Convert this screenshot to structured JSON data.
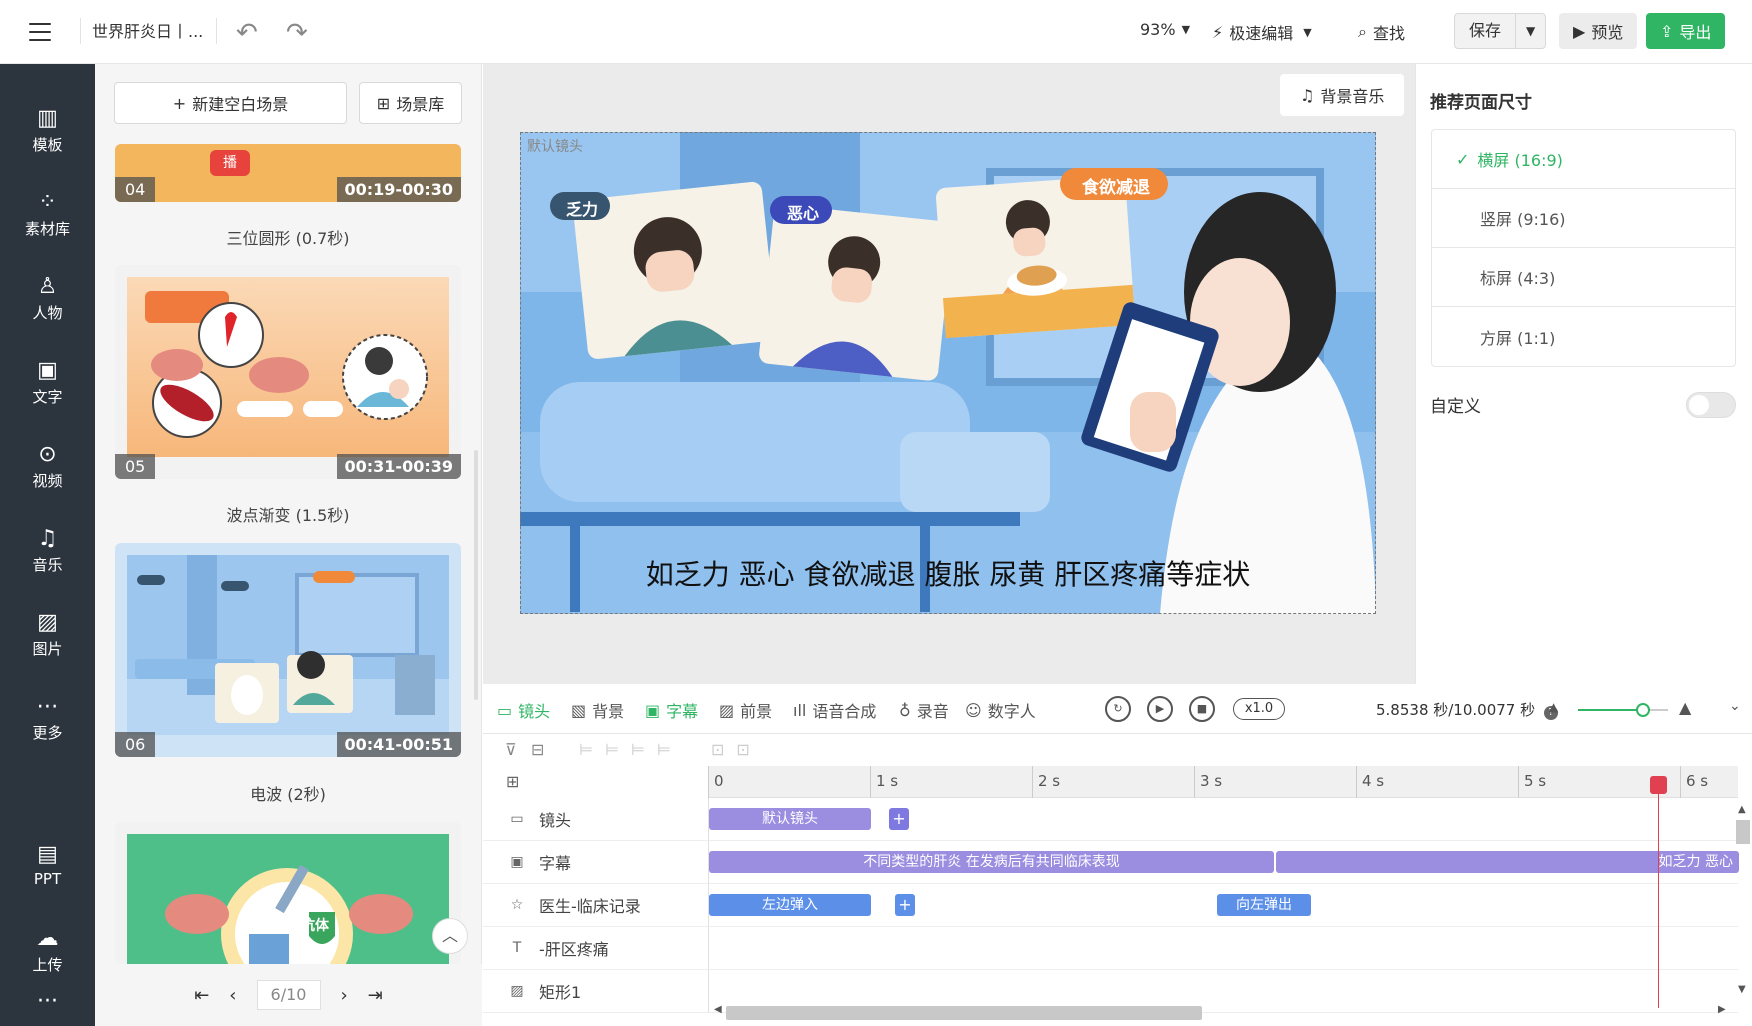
{
  "topbar": {
    "doc_title": "世界肝炎日丨...",
    "zoom": "93%",
    "quick_edit": "极速编辑",
    "find": "查找",
    "save": "保存",
    "preview": "预览",
    "export": "导出"
  },
  "nav": {
    "items": [
      {
        "label": "模板",
        "icon": "template-icon"
      },
      {
        "label": "素材库",
        "icon": "material-library-icon"
      },
      {
        "label": "人物",
        "icon": "person-icon"
      },
      {
        "label": "文字",
        "icon": "text-icon"
      },
      {
        "label": "视频",
        "icon": "video-icon"
      },
      {
        "label": "音乐",
        "icon": "music-icon"
      },
      {
        "label": "图片",
        "icon": "image-icon"
      },
      {
        "label": "更多",
        "icon": "more-icon"
      },
      {
        "label": "PPT",
        "icon": "ppt-icon"
      },
      {
        "label": "上传",
        "icon": "upload-icon"
      }
    ]
  },
  "scenes": {
    "new_blank": "新建空白场景",
    "library": "场景库",
    "items": [
      {
        "num": "04",
        "time": "00:19-00:30",
        "transition": "三位圆形 (0.7秒)",
        "thumb_text": "播"
      },
      {
        "num": "05",
        "time": "00:31-00:39",
        "transition": "波点渐变 (1.5秒)"
      },
      {
        "num": "06",
        "time": "00:41-00:51",
        "transition": "电波 (2秒)"
      }
    ],
    "next_thumb_text": "抗体",
    "page": "6/10"
  },
  "canvas": {
    "bgm": "背景音乐",
    "camera_label": "默认镜头",
    "subtitle": "如乏力 恶心 食欲减退 腹胀 尿黄 肝区疼痛等症状",
    "tag1": "乏力",
    "tag2": "恶心",
    "tag3": "食欲减退"
  },
  "right_panel": {
    "title": "推荐页面尺寸",
    "options": [
      "横屏 (16:9)",
      "竖屏 (9:16)",
      "标屏 (4:3)",
      "方屏 (1:1)"
    ],
    "selected_index": 0,
    "custom_label": "自定义",
    "custom_enabled": false
  },
  "timeline": {
    "tabs": [
      "镜头",
      "背景",
      "字幕",
      "前景",
      "语音合成",
      "录音",
      "数字人"
    ],
    "active_tab": "字幕",
    "speed": "x1.0",
    "time_display": "5.8538 秒/10.0077 秒",
    "ruler": [
      "0",
      "1 s",
      "2 s",
      "3 s",
      "4 s",
      "5 s",
      "6 s"
    ],
    "tracks": [
      {
        "label": "镜头",
        "clips": [
          "默认镜头"
        ]
      },
      {
        "label": "字幕",
        "clips": [
          "不同类型的肝炎 在发病后有共同临床表现",
          "如乏力 恶心"
        ]
      },
      {
        "label": "医生-临床记录",
        "clips": [
          "左边弹入",
          "向左弹出"
        ]
      },
      {
        "label": "-肝区疼痛",
        "clips": []
      },
      {
        "label": "矩形1",
        "clips": []
      }
    ]
  },
  "colors": {
    "accent": "#2fb563",
    "nav_bg": "#2c343e",
    "clip_purple": "#9b8de0",
    "clip_blue": "#5b8fe8",
    "playhead": "#e04050"
  }
}
